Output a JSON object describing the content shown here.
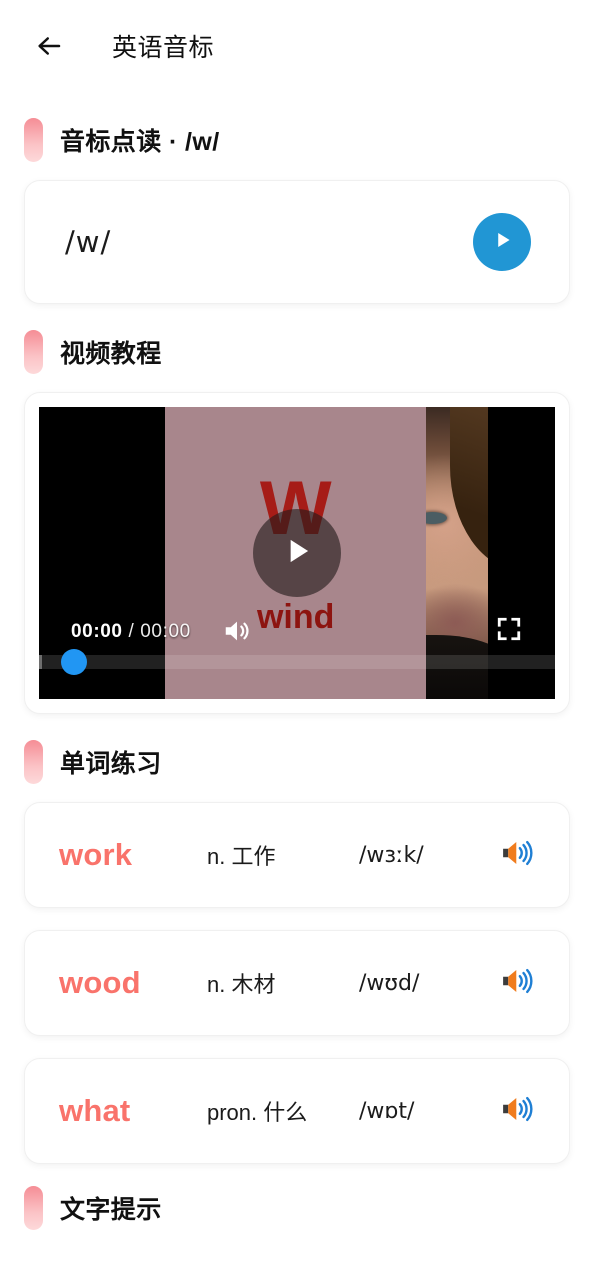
{
  "header": {
    "back_icon": "arrow-left-icon",
    "title": "英语音标"
  },
  "theme": {
    "accent_pink": "#f58d95",
    "word_coral": "#f9736b",
    "play_blue": "#2196d4",
    "scrubber_blue": "#2196f3",
    "speaker_orange": "#f07c1e",
    "speaker_wave_blue": "#1f7fd4",
    "page_bg": "#ffffff",
    "card_bg": "#ffffff",
    "slide_red": "#a61c17"
  },
  "sections": {
    "phonetic_read": {
      "title": "音标点读 · /w/",
      "symbol": "/w/",
      "play_icon": "play-icon"
    },
    "video_tutorial": {
      "title": "视频教程",
      "player": {
        "current_time": "00:00",
        "separator": "/",
        "duration": "00:00",
        "play_overlay_icon": "play-icon",
        "mute_icon": "volume-icon",
        "fullscreen_icon": "fullscreen-icon",
        "progress_percent": 0,
        "slide_letter": "W",
        "slide_word": "wind"
      }
    },
    "word_practice": {
      "title": "单词练习",
      "words": [
        {
          "term": "work",
          "meaning": "n. 工作",
          "phonetic": "/wɜːk/",
          "speaker_icon": "volume-icon"
        },
        {
          "term": "wood",
          "meaning": "n. 木材",
          "phonetic": "/wʊd/",
          "speaker_icon": "volume-icon"
        },
        {
          "term": "what",
          "meaning": "pron. 什么",
          "phonetic": "/wɒt/",
          "speaker_icon": "volume-icon"
        }
      ]
    },
    "text_tips": {
      "title": "文字提示"
    }
  }
}
